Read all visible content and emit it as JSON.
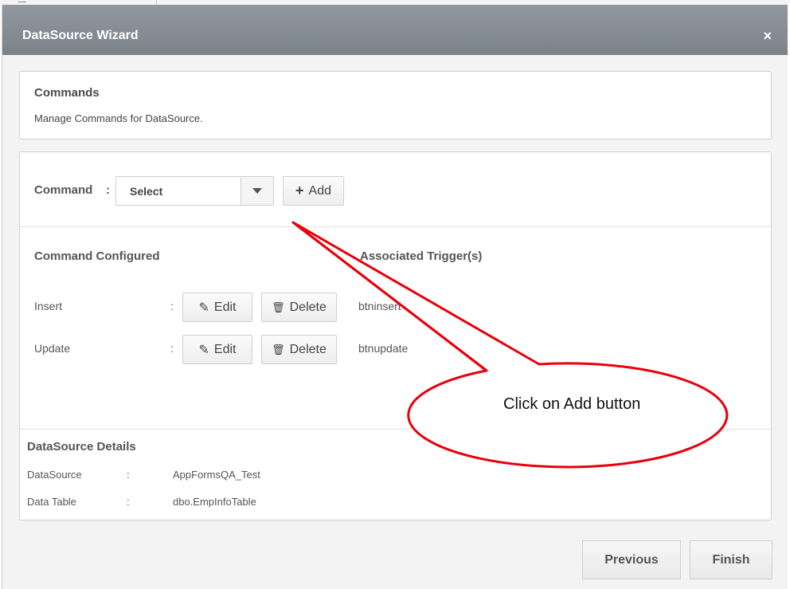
{
  "dialog": {
    "title": "DataSource Wizard",
    "close_icon": "×"
  },
  "commands_panel": {
    "heading": "Commands",
    "description": "Manage Commands for DataSource."
  },
  "command_row": {
    "label": "Command",
    "colon": ":",
    "select_value": "Select",
    "add_label": "Add",
    "add_icon": "+"
  },
  "configured": {
    "heading": "Command Configured",
    "trigger_heading": "Associated Trigger(s)",
    "rows": [
      {
        "name": "Insert",
        "colon": ":",
        "edit_label": "Edit",
        "delete_label": "Delete",
        "trigger": "btninsert"
      },
      {
        "name": "Update",
        "colon": ":",
        "edit_label": "Edit",
        "delete_label": "Delete",
        "trigger": "btnupdate"
      }
    ]
  },
  "details": {
    "heading": "DataSource Details",
    "rows": [
      {
        "label": "DataSource",
        "colon": ":",
        "value": "AppFormsQA_Test"
      },
      {
        "label": "Data Table",
        "colon": ":",
        "value": "dbo.EmpInfoTable"
      }
    ]
  },
  "footer": {
    "previous_label": "Previous",
    "finish_label": "Finish"
  },
  "annotation": {
    "text": "Click on Add button",
    "color": "#e8000b"
  }
}
